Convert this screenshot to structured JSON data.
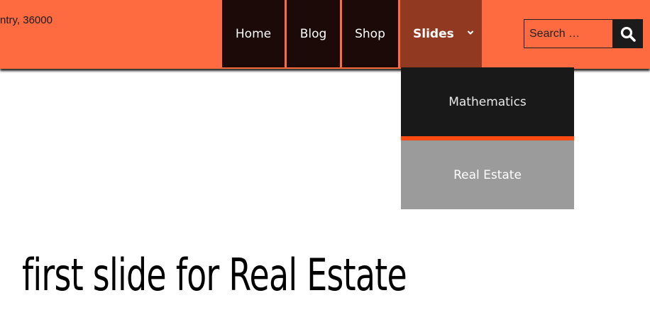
{
  "header": {
    "address": "ntry, 36000",
    "background_color": "#ff6b40"
  },
  "nav": {
    "items": [
      {
        "label": "Home"
      },
      {
        "label": "Blog"
      },
      {
        "label": "Shop"
      },
      {
        "label": "Slides",
        "active": true,
        "icon": "chevron-down-icon"
      }
    ],
    "item_color": "#1b0a07",
    "active_color": "#913a21"
  },
  "search": {
    "placeholder": "Search …",
    "button_icon": "search-icon"
  },
  "dropdown": {
    "items": [
      {
        "label": "Mathematics"
      },
      {
        "label": "Real Estate"
      }
    ]
  },
  "main": {
    "title": "first slide for Real Estate"
  }
}
